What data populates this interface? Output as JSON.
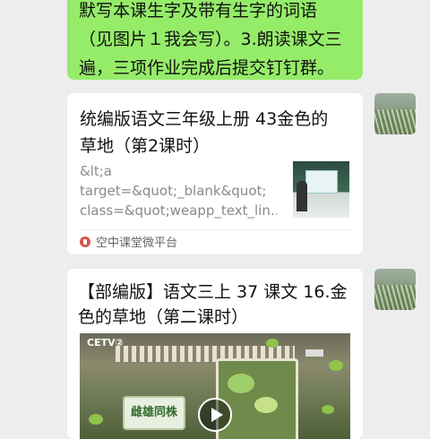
{
  "green_message": {
    "lines": [
      "默写本课生字及带有生字的词语",
      "（见图片１我会写）。3.朗读课文三",
      "遍，三项作业完成后提交钉钉群。"
    ]
  },
  "card1": {
    "title_lines": [
      "统编版语文三年级上册 43金色的",
      "草地（第2课时）"
    ],
    "desc_lines": [
      "&lt;a",
      "target=&quot;_blank&quot;",
      "class=&quot;weapp_text_lin..."
    ],
    "source": "空中课堂微平台"
  },
  "card2": {
    "title_lines": [
      "【部编版】语文三上 37 课文 16.金",
      "色的草地（第二课时）"
    ],
    "video": {
      "channel_logo": "CETV②",
      "sign_text": "雌雄同株"
    }
  },
  "icons": {
    "source_icon": "platform-logo-icon",
    "play_icon": "play-icon"
  },
  "colors": {
    "bubble": "#95ec69",
    "background": "#ededed",
    "card": "#ffffff"
  }
}
